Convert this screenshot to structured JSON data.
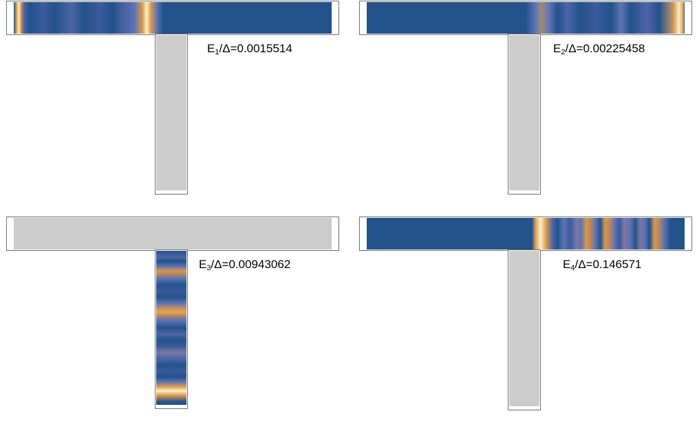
{
  "colors": {
    "off": "#cccccc",
    "bg": "#23538a",
    "mid": "#5d73b6",
    "warm": "#d6974f",
    "hot": "#fff0c2"
  },
  "panels": [
    {
      "label": {
        "E": "E",
        "sub": "1",
        "rest": "/Δ=0.0015514"
      }
    },
    {
      "label": {
        "E": "E",
        "sub": "2",
        "rest": "/Δ=0.00225458"
      }
    },
    {
      "label": {
        "E": "E",
        "sub": "3",
        "rest": "/Δ=0.00943062"
      }
    },
    {
      "label": {
        "E": "E",
        "sub": "4",
        "rest": "/Δ=0.146571"
      }
    }
  ]
}
